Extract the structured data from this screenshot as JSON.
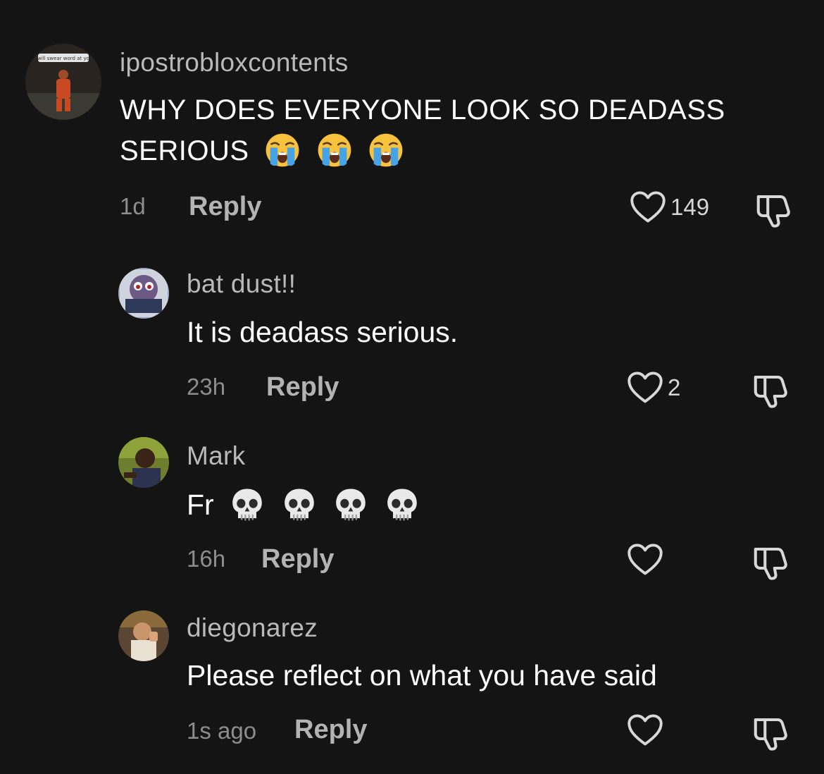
{
  "comments": [
    {
      "username": "ipostrobloxcontents",
      "text": "WHY DOES EVERYONE LOOK SO DEADASS",
      "text_line2": "SERIOUS",
      "emojis": [
        "loudly-crying-face",
        "loudly-crying-face",
        "loudly-crying-face"
      ],
      "time": "1d",
      "reply_label": "Reply",
      "likes": "149",
      "avatar_caption": "I will swear word at you"
    },
    {
      "username": "bat dust!!",
      "text": "It is deadass serious.",
      "time": "23h",
      "reply_label": "Reply",
      "likes": "2"
    },
    {
      "username": "Mark",
      "text": "Fr",
      "emojis": [
        "skull",
        "skull",
        "skull",
        "skull"
      ],
      "time": "16h",
      "reply_label": "Reply",
      "likes": ""
    },
    {
      "username": "diegonarez",
      "text": "Please reflect on what you have said",
      "time": "1s ago",
      "reply_label": "Reply",
      "likes": ""
    }
  ],
  "icons": {
    "like": "heart-outline-icon",
    "dislike": "thumbs-down-outline-icon"
  },
  "colors": {
    "background": "#141414",
    "username": "#b9b9b9",
    "text": "#ffffff",
    "meta": "#8d8d8d"
  }
}
